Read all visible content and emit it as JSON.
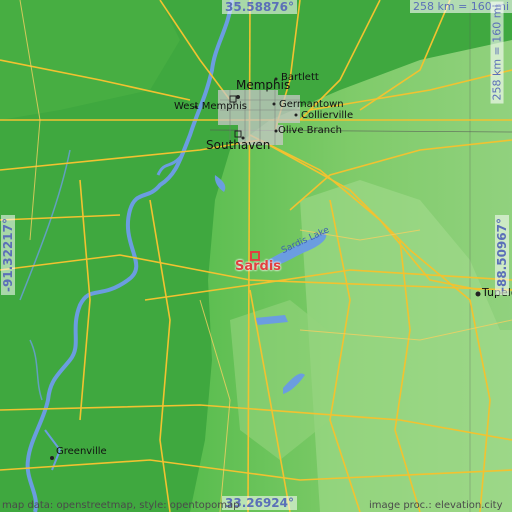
{
  "map": {
    "coords": {
      "top": "35.58876°",
      "bottom": "33.26924°",
      "left": "-91.32217°",
      "right": "-88.50967°"
    },
    "scale_top": "258 km = 160 mi",
    "scale_right": "258 km = 160 mi",
    "places": {
      "sardis": "Sardis",
      "memphis": "Memphis",
      "west_memphis": "West Memphis",
      "bartlett": "Bartlett",
      "germantown": "Germantown",
      "collierville": "Collierville",
      "olive_branch": "Olive Branch",
      "southaven": "Southaven",
      "sardis_lake": "Sardis Lake",
      "tupelo": "Tupelo",
      "greenville": "Greenville"
    },
    "attribution_left": "map data: openstreetmap, style: opentopomap",
    "attribution_right": "image proc.: elevation.city",
    "colors": {
      "lowland": "#3fa83f",
      "upland": "#8fd07a",
      "water": "#6b9de0",
      "roads": "#f2c230",
      "marker": "#e04040"
    }
  }
}
